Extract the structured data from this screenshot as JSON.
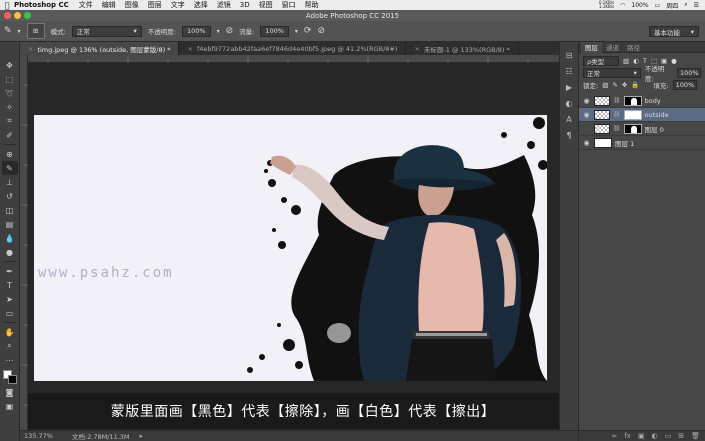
{
  "menubar": {
    "app_name": "Photoshop CC",
    "items": [
      "文件",
      "编辑",
      "图像",
      "图层",
      "文字",
      "选择",
      "滤镜",
      "3D",
      "视图",
      "窗口",
      "帮助"
    ],
    "net_up": "0.1KB/s",
    "net_down": "1.1KB/s",
    "battery": "100%",
    "day": "周四"
  },
  "titlebar": {
    "title": "Adobe Photoshop CC 2015"
  },
  "options": {
    "mode_label": "模式:",
    "mode_value": "正常",
    "opacity_label": "不透明度:",
    "opacity_value": "100%",
    "flow_label": "流量:",
    "flow_value": "100%",
    "workspace": "基本功能"
  },
  "tabs": [
    {
      "label": "timg.jpeg @ 136% (outside, 图层蒙版/8) *",
      "active": true
    },
    {
      "label": "f4ebf9772abb42faa6ef7846d4e40bf5.jpeg @ 41.2%(RGB/8#)",
      "active": false
    },
    {
      "label": "未标题-1 @ 133%(RGB/8) *",
      "active": false
    }
  ],
  "canvas": {
    "watermark": "www.psahz.com"
  },
  "subtitle": "蒙版里面画【黑色】代表【擦除】，画【白色】代表【擦出】",
  "status": {
    "zoom": "135.77%",
    "doc": "文档:2.78M/11.3M"
  },
  "layers_panel": {
    "tabs": [
      "图层",
      "通道",
      "路径"
    ],
    "kind_filter": "ρ类型",
    "blend_mode": "正常",
    "opacity_label": "不透明度:",
    "opacity_value": "100%",
    "lock_label": "锁定:",
    "fill_label": "填充:",
    "fill_value": "100%",
    "layers": [
      {
        "name": "body",
        "selected": false,
        "thumb": "trans",
        "mask": "black"
      },
      {
        "name": "outside",
        "selected": true,
        "thumb": "trans",
        "mask": "white"
      },
      {
        "name": "图层 0",
        "selected": false,
        "thumb": "trans",
        "mask": "black"
      },
      {
        "name": "图层 1",
        "selected": false,
        "thumb": "white",
        "mask": ""
      }
    ],
    "bottom_icons": [
      "∞",
      "fx",
      "▣",
      "◐",
      "▭",
      "⊞",
      "🗑"
    ]
  },
  "colors": {
    "foreground": "#ffffff",
    "background": "#000000",
    "selected_layer": "#5a6b83",
    "canvas_bg": "#f1f1f7"
  }
}
